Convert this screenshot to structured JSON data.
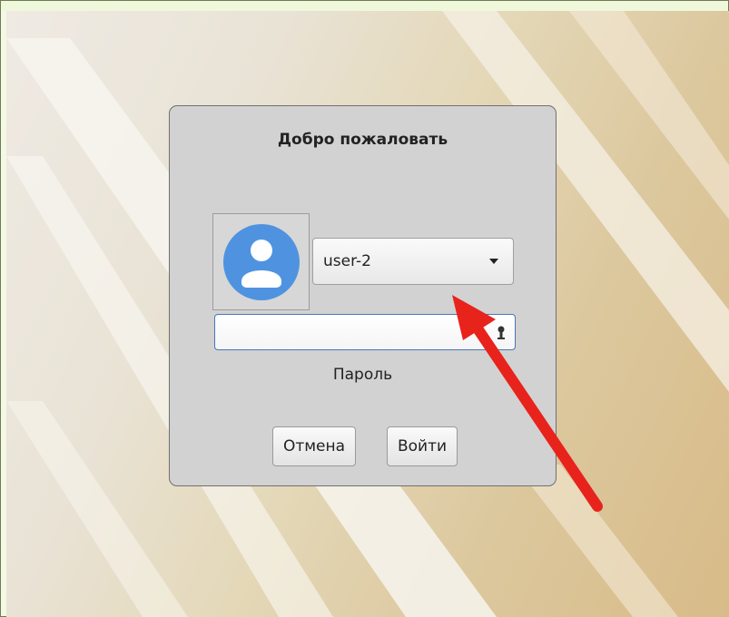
{
  "dialog": {
    "title": "Добро пожаловать",
    "user_select": {
      "value": "user-2"
    },
    "password": {
      "value": "",
      "label": "Пароль"
    },
    "buttons": {
      "cancel": "Отмена",
      "login": "Войти"
    }
  },
  "colors": {
    "accent_blue": "#4a76b6",
    "avatar_blue": "#4f93e0",
    "annotation_arrow": "#e8231c"
  },
  "icons": [
    "user-avatar-icon",
    "dropdown-caret-icon",
    "key-lock-icon",
    "annotation-arrow"
  ]
}
